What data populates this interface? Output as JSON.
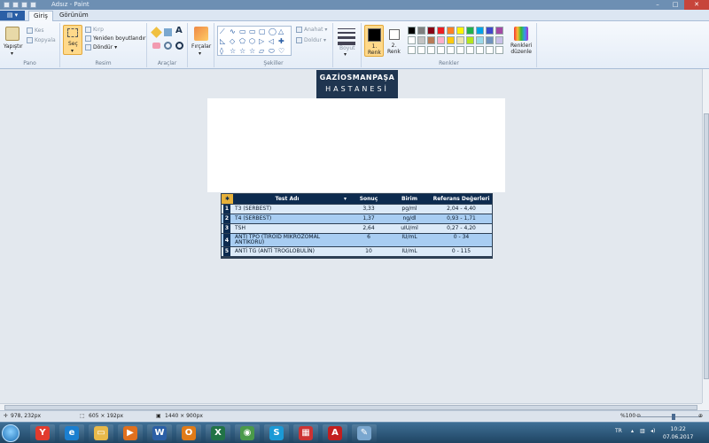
{
  "window": {
    "title": "Adsız - Paint",
    "min_glyph": "–",
    "max_glyph": "□",
    "close_glyph": "✕"
  },
  "tabs": {
    "file_glyph": "▤ ▾",
    "home": "Giriş",
    "view": "Görünüm"
  },
  "ribbon": {
    "clipboard": {
      "paste": "Yapıştır",
      "paste_arrow": "▾",
      "cut": "Kes",
      "copy": "Kopyala",
      "group": "Pano"
    },
    "image": {
      "select": "Seç",
      "select_arrow": "▾",
      "crop": "Kırp",
      "resize": "Yeniden boyutlandır",
      "rotate": "Döndür ▾",
      "group": "Resim"
    },
    "tools": {
      "group": "Araçlar"
    },
    "brushes": {
      "label": "Fırçalar",
      "arrow": "▾"
    },
    "shapes": {
      "outline": "Anahat ▾",
      "fill": "Doldur ▾",
      "group": "Şekiller",
      "gallery": [
        "⟋",
        "∿",
        "▭",
        "▭",
        "▢",
        "◯",
        "△",
        "◺",
        "◇",
        "⬠",
        "⬡",
        "▷",
        "◁",
        "✚",
        "◊",
        "☆",
        "☆",
        "☆",
        "▱",
        "⬭",
        "♡"
      ]
    },
    "size": {
      "label": "Boyut",
      "arrow": "▾"
    },
    "colors": {
      "color1": "1.\nRenk",
      "color2": "2.\nRenk",
      "edit": "Renkleri\ndüzenle",
      "group": "Renkler",
      "palette_row1": [
        "#000000",
        "#7f7f7f",
        "#880015",
        "#ed1c24",
        "#ff7f27",
        "#fff200",
        "#22b14c",
        "#00a2e8",
        "#3f48cc",
        "#a349a4"
      ],
      "palette_row2": [
        "#ffffff",
        "#c3c3c3",
        "#b97a57",
        "#ffaec9",
        "#ffc90e",
        "#efe4b0",
        "#b5e61d",
        "#99d9ea",
        "#7092be",
        "#c8bfe7"
      ],
      "palette_row3": [
        "#ffffff",
        "#ffffff",
        "#ffffff",
        "#ffffff",
        "#ffffff",
        "#ffffff",
        "#ffffff",
        "#ffffff",
        "#ffffff",
        "#ffffff"
      ]
    }
  },
  "logo": {
    "line1": "GAZİOSMANPAŞA",
    "line2": "HASTANESİ"
  },
  "table": {
    "headers": {
      "star": "✱",
      "test": "Test Adı",
      "flag": "▾",
      "result": "Sonuç",
      "unit": "Birim",
      "ref": "Referans Değerleri"
    },
    "rows": [
      {
        "n": "1",
        "test": "T3 (SERBEST)",
        "result": "3,33",
        "unit": "pg/ml",
        "ref": "2,04 - 4,40"
      },
      {
        "n": "2",
        "test": "T4 (SERBEST)",
        "result": "1,37",
        "unit": "ng/dl",
        "ref": "0,93 - 1,71"
      },
      {
        "n": "3",
        "test": "TSH",
        "result": "2,64",
        "unit": "uIU/ml",
        "ref": "0,27 - 4,20"
      },
      {
        "n": "4",
        "test": "ANTİ TPO (TİROİD MİKROZOMAL ANTİKORU)",
        "result": "6",
        "unit": "IU/mL",
        "ref": "0 - 34"
      },
      {
        "n": "5",
        "test": "ANTİ TG (ANTİ TROGLOBULİN)",
        "result": "10",
        "unit": "IU/mL",
        "ref": "0 - 115"
      }
    ]
  },
  "status": {
    "cursor": "978, 232px",
    "selection": "605 × 192px",
    "image_size": "1440 × 900px",
    "zoom": "%100",
    "zoom_minus": "⊖",
    "zoom_plus": "⊕",
    "zoom_level": 1.0
  },
  "taskbar": {
    "apps": [
      {
        "name": "yandex",
        "label": "Y",
        "color": "#e23b2e"
      },
      {
        "name": "ie",
        "label": "e",
        "color": "#1b7fd0"
      },
      {
        "name": "explorer",
        "label": "▭",
        "color": "#e8b94a"
      },
      {
        "name": "media",
        "label": "▶",
        "color": "#e0701e"
      },
      {
        "name": "word",
        "label": "W",
        "color": "#2b5fa6"
      },
      {
        "name": "outlook",
        "label": "O",
        "color": "#e07b18"
      },
      {
        "name": "excel",
        "label": "X",
        "color": "#217346"
      },
      {
        "name": "chrome",
        "label": "◉",
        "color": "#4a9a4a"
      },
      {
        "name": "skype",
        "label": "S",
        "color": "#1b9ad6"
      },
      {
        "name": "app10",
        "label": "▦",
        "color": "#c33"
      },
      {
        "name": "acrobat",
        "label": "A",
        "color": "#c31e1e"
      },
      {
        "name": "paint",
        "label": "✎",
        "color": "#7aa7cf"
      }
    ],
    "lang": "TR",
    "time": "10:22",
    "date": "07.06.2017"
  },
  "colors": {
    "accent": "#2b5fa6",
    "table_header": "#0d2b4f",
    "row_light": "#dceaf8",
    "row_dark": "#a8cdf2"
  }
}
